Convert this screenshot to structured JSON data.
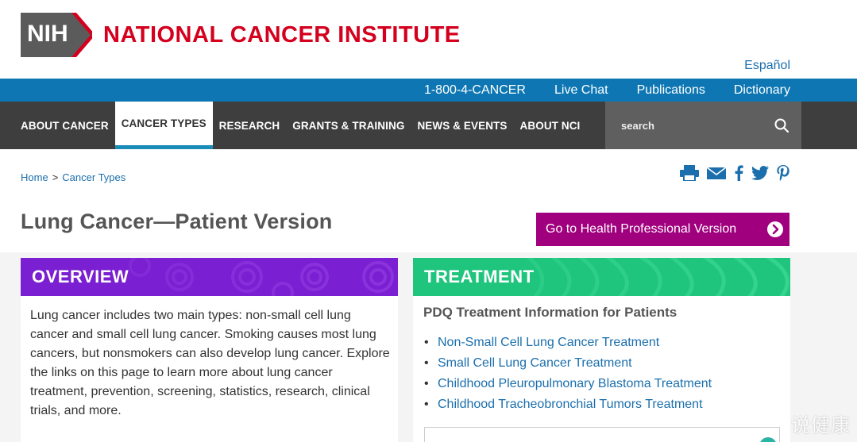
{
  "header": {
    "logo_text": "NIH",
    "institute_name": "NATIONAL CANCER INSTITUTE",
    "language_link": "Español"
  },
  "utility_bar": {
    "phone": "1-800-4-CANCER",
    "live_chat": "Live Chat",
    "publications": "Publications",
    "dictionary": "Dictionary"
  },
  "nav": {
    "items": [
      {
        "label": "ABOUT CANCER",
        "active": false
      },
      {
        "label": "CANCER TYPES",
        "active": true
      },
      {
        "label": "RESEARCH",
        "active": false
      },
      {
        "label": "GRANTS & TRAINING",
        "active": false
      },
      {
        "label": "NEWS & EVENTS",
        "active": false
      },
      {
        "label": "ABOUT NCI",
        "active": false
      }
    ],
    "search_placeholder": "search"
  },
  "breadcrumb": {
    "home": "Home",
    "separator": ">",
    "current": "Cancer Types"
  },
  "share_icons": [
    "print-icon",
    "email-icon",
    "facebook-icon",
    "twitter-icon",
    "pinterest-icon"
  ],
  "page": {
    "title": "Lung Cancer—Patient Version",
    "hp_button": "Go to Health Professional Version"
  },
  "overview": {
    "heading": "OVERVIEW",
    "text": "Lung cancer includes two main types: non-small cell lung cancer and small cell lung cancer. Smoking causes most lung cancers, but nonsmokers can also develop lung cancer. Explore the links on this page to learn more about lung cancer treatment, prevention, screening, statistics, research, clinical trials, and more."
  },
  "treatment": {
    "heading": "TREATMENT",
    "pdq_title": "PDQ Treatment Information for Patients",
    "links": [
      "Non-Small Cell Lung Cancer Treatment",
      "Small Cell Lung Cancer Treatment",
      "Childhood Pleuropulmonary Blastoma Treatment",
      "Childhood Tracheobronchial Tumors Treatment"
    ]
  },
  "watermark": "说健康",
  "colors": {
    "nci_red": "#d4001e",
    "util_blue": "#0e77b3",
    "nav_dark": "#3e3e3e",
    "purple": "#7a1fd1",
    "green": "#1fc57d",
    "magenta": "#a0007e",
    "link_blue": "#1b6fad"
  }
}
